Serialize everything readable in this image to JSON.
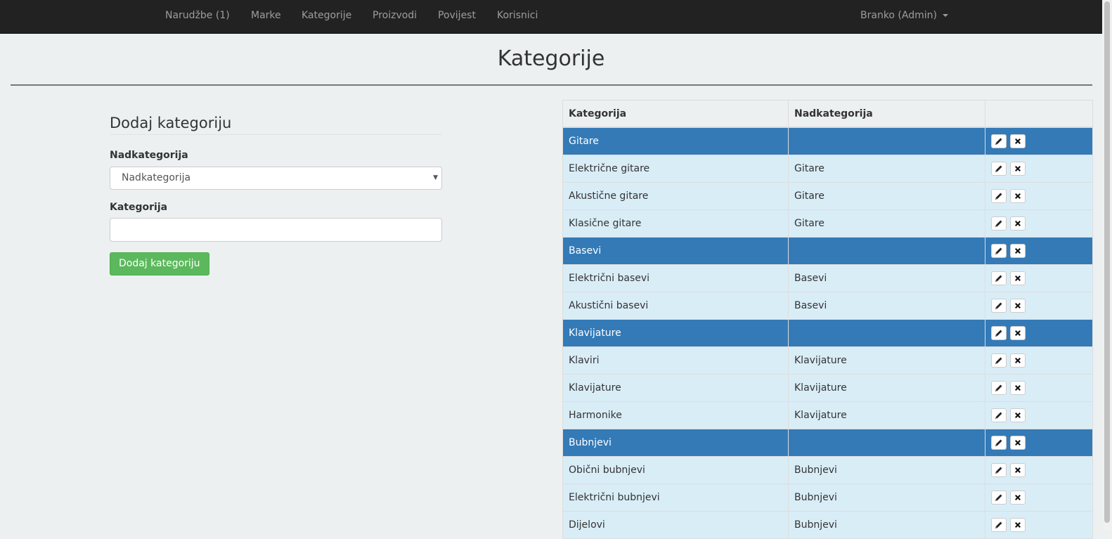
{
  "navbar": {
    "items": [
      {
        "label": "Narudžbe (1)"
      },
      {
        "label": "Marke"
      },
      {
        "label": "Kategorije"
      },
      {
        "label": "Proizvodi"
      },
      {
        "label": "Povijest"
      },
      {
        "label": "Korisnici"
      }
    ],
    "user_label": "Branko (Admin)"
  },
  "page": {
    "title": "Kategorije"
  },
  "form": {
    "title": "Dodaj kategoriju",
    "parent_label": "Nadkategorija",
    "parent_selected": "Nadkategorija",
    "category_label": "Kategorija",
    "category_value": "",
    "submit_label": "Dodaj kategoriju"
  },
  "table": {
    "headers": [
      "Kategorija",
      "Nadkategorija",
      ""
    ],
    "rows": [
      {
        "name": "Gitare",
        "parent": "",
        "is_parent": true
      },
      {
        "name": "Električne gitare",
        "parent": "Gitare",
        "is_parent": false
      },
      {
        "name": "Akustične gitare",
        "parent": "Gitare",
        "is_parent": false
      },
      {
        "name": "Klasične gitare",
        "parent": "Gitare",
        "is_parent": false
      },
      {
        "name": "Basevi",
        "parent": "",
        "is_parent": true
      },
      {
        "name": "Električni basevi",
        "parent": "Basevi",
        "is_parent": false
      },
      {
        "name": "Akustični basevi",
        "parent": "Basevi",
        "is_parent": false
      },
      {
        "name": "Klavijature",
        "parent": "",
        "is_parent": true
      },
      {
        "name": "Klaviri",
        "parent": "Klavijature",
        "is_parent": false
      },
      {
        "name": "Klavijature",
        "parent": "Klavijature",
        "is_parent": false
      },
      {
        "name": "Harmonike",
        "parent": "Klavijature",
        "is_parent": false
      },
      {
        "name": "Bubnjevi",
        "parent": "",
        "is_parent": true
      },
      {
        "name": "Obični bubnjevi",
        "parent": "Bubnjevi",
        "is_parent": false
      },
      {
        "name": "Električni bubnjevi",
        "parent": "Bubnjevi",
        "is_parent": false
      },
      {
        "name": "Dijelovi",
        "parent": "Bubnjevi",
        "is_parent": false
      }
    ],
    "edit_icon": "pencil-icon",
    "delete_icon": "remove-icon"
  },
  "colors": {
    "navbar_bg": "#222222",
    "page_bg": "#ecf0f1",
    "parent_row": "#337ab7",
    "child_row": "#d9edf7",
    "success_button": "#5cb85c"
  }
}
